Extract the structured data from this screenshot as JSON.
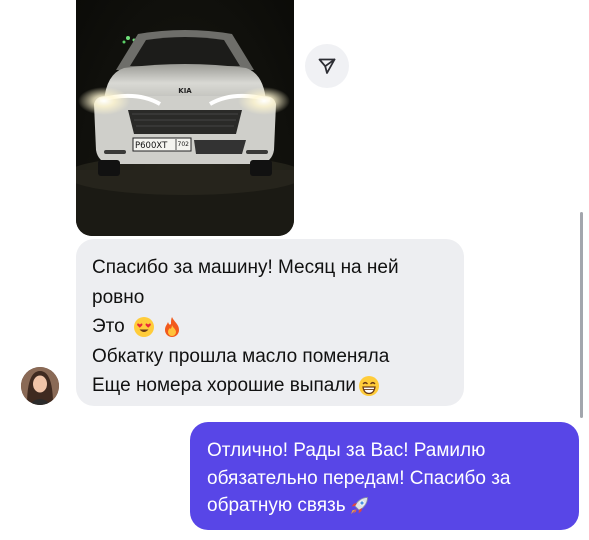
{
  "incoming": {
    "lines": [
      "Спасибо за машину! Месяц на ней",
      "ровно",
      "Это",
      "Обкатку прошла масло поменяла",
      "Еще номера хорошие выпали"
    ],
    "emojis": [
      "heart-eyes-emoji",
      "fire-emoji",
      "grinning-emoji"
    ]
  },
  "photo": {
    "plate_text": "Р600ХТ",
    "plate_region": "702",
    "badge_text": "KIA"
  },
  "outgoing": {
    "lines": [
      "Отлично! Рады за Вас! Рамилю",
      "обязательно передам! Спасибо за",
      "обратную связь"
    ],
    "emoji": "rocket-emoji"
  },
  "colors": {
    "outgoing_bubble": "#5846e7",
    "incoming_bubble": "#edeef1",
    "share_button_bg": "#f0f1f4"
  },
  "icons": {
    "share": "send-arrow-icon"
  }
}
